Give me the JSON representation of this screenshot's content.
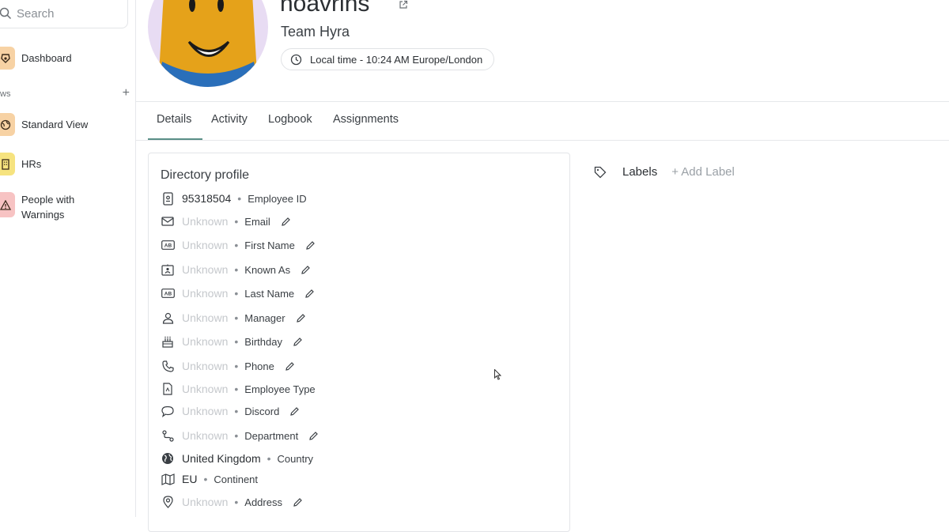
{
  "sidebar": {
    "search_placeholder": "Search",
    "dashboard_label": "Dashboard",
    "views_header": "ws",
    "views_add": "+",
    "items": [
      {
        "label": "Standard View",
        "icon": "globe-icon",
        "color": "#f7d2a4"
      },
      {
        "label": "HRs",
        "icon": "building-icon",
        "color": "#f6e37f"
      },
      {
        "label": "People with\nWarnings",
        "icon": "warning-icon",
        "color": "#f7c3c3"
      }
    ],
    "dashboard_color": "#f7d2a4"
  },
  "header": {
    "user_name": "noavrins",
    "team": "Team Hyra",
    "local_time": "Local time - 10:24 AM Europe/London",
    "avatar_bg": "#e8dcf3"
  },
  "tabs": [
    {
      "label": "Details",
      "active": true
    },
    {
      "label": "Activity",
      "active": false
    },
    {
      "label": "Logbook",
      "active": false
    },
    {
      "label": "Assignments",
      "active": false
    }
  ],
  "profile": {
    "title": "Directory profile",
    "rows": [
      {
        "icon": "id-badge-icon",
        "value": "95318504",
        "unknown": false,
        "label": "Employee ID",
        "editable": false
      },
      {
        "icon": "mail-icon",
        "value": "Unknown",
        "unknown": true,
        "label": "Email",
        "editable": true
      },
      {
        "icon": "ab-icon",
        "value": "Unknown",
        "unknown": true,
        "label": "First Name",
        "editable": true
      },
      {
        "icon": "contact-card-icon",
        "value": "Unknown",
        "unknown": true,
        "label": "Known As",
        "editable": true
      },
      {
        "icon": "ab-icon",
        "value": "Unknown",
        "unknown": true,
        "label": "Last Name",
        "editable": true
      },
      {
        "icon": "manager-icon",
        "value": "Unknown",
        "unknown": true,
        "label": "Manager",
        "editable": true
      },
      {
        "icon": "cake-icon",
        "value": "Unknown",
        "unknown": true,
        "label": "Birthday",
        "editable": true
      },
      {
        "icon": "phone-icon",
        "value": "Unknown",
        "unknown": true,
        "label": "Phone",
        "editable": true
      },
      {
        "icon": "document-icon",
        "value": "Unknown",
        "unknown": true,
        "label": "Employee Type",
        "editable": false
      },
      {
        "icon": "chat-bubble-icon",
        "value": "Unknown",
        "unknown": true,
        "label": "Discord",
        "editable": true
      },
      {
        "icon": "route-icon",
        "value": "Unknown",
        "unknown": true,
        "label": "Department",
        "editable": true
      },
      {
        "icon": "globe-icon",
        "value": "United Kingdom",
        "unknown": false,
        "label": "Country",
        "editable": false
      },
      {
        "icon": "map-icon",
        "value": "EU",
        "unknown": false,
        "label": "Continent",
        "editable": false
      },
      {
        "icon": "location-pin-icon",
        "value": "Unknown",
        "unknown": true,
        "label": "Address",
        "editable": true
      }
    ]
  },
  "labels": {
    "title": "Labels",
    "add": "+ Add Label"
  },
  "colors": {
    "accent": "#5a8f87",
    "unknown_text": "#c5c8cc"
  }
}
